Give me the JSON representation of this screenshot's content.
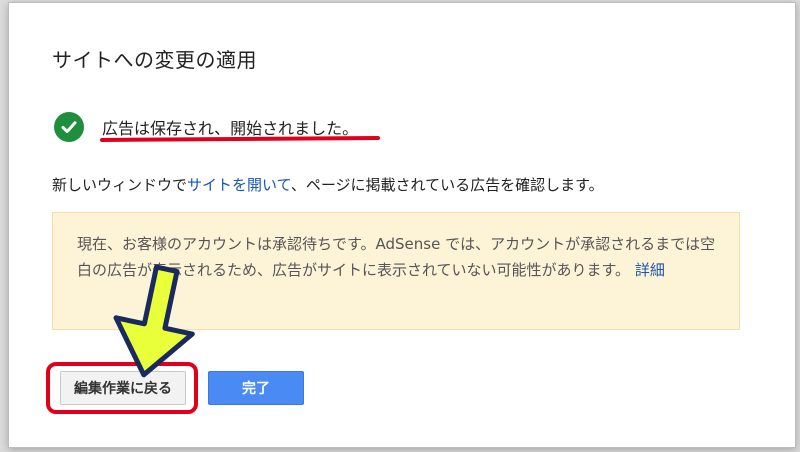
{
  "dialog": {
    "title": "サイトへの変更の適用",
    "success_message": "広告は保存され、開始されました。",
    "info_prefix": "新しいウィンドウで",
    "info_link": "サイトを開いて",
    "info_suffix": "、ページに掲載されている広告を確認します。",
    "notice": {
      "text": "現在、お客様のアカウントは承認待ちです。AdSense では、アカウントが承認されるまでは空白の広告が表示されるため、広告がサイトに表示されていない可能性があります。",
      "link": "詳細"
    },
    "buttons": {
      "back_label": "編集作業に戻る",
      "done_label": "完了"
    }
  },
  "colors": {
    "success_green": "#1f8e3d",
    "link_blue": "#1a57b0",
    "primary_blue": "#4a8af4",
    "notice_bg": "#fdf3d6",
    "highlight_red": "#e0001b",
    "arrow_fill": "#e8ff3a"
  },
  "icons": {
    "success": "check-circle-icon",
    "annotation": "down-arrow-icon"
  }
}
